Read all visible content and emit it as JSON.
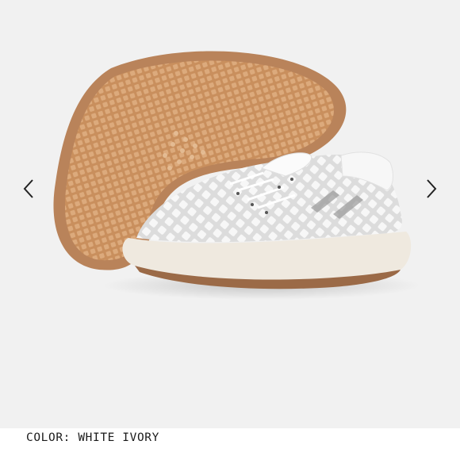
{
  "gallery": {
    "image_alt": "White Ivory knit sneaker with gum sole",
    "prev_icon": "chevron-left-icon",
    "next_icon": "chevron-right-icon"
  },
  "product": {
    "color_label": "COLOR:",
    "color_value": "WHITE IVORY"
  },
  "colors": {
    "background": "#f1f1f1",
    "gum_sole": "#cf9a6a",
    "upper": "#f4f4f4",
    "midsole": "#efe9df",
    "text": "#1a1a1a"
  }
}
